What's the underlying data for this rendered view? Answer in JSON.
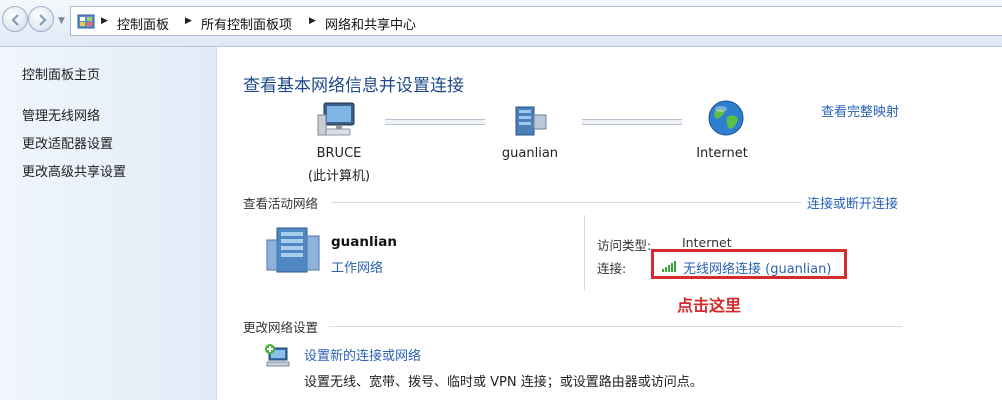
{
  "address_bar": {
    "breadcrumbs": [
      "控制面板",
      "所有控制面板项",
      "网络和共享中心"
    ]
  },
  "sidebar": {
    "home": "控制面板主页",
    "items": [
      "管理无线网络",
      "更改适配器设置",
      "更改高级共享设置"
    ]
  },
  "main": {
    "title": "查看基本网络信息并设置连接",
    "full_map_link": "查看完整映射",
    "map_nodes": [
      {
        "label": "BRUCE",
        "sublabel": "(此计算机)",
        "icon": "computer-icon"
      },
      {
        "label": "guanlian",
        "icon": "network-icon"
      },
      {
        "label": "Internet",
        "icon": "globe-icon"
      }
    ],
    "active_networks": {
      "heading": "查看活动网络",
      "connect_link": "连接或断开连接",
      "network_name": "guanlian",
      "network_type": "工作网络",
      "access_type_label": "访问类型:",
      "access_type_value": "Internet",
      "connection_label": "连接:",
      "connection_value": "无线网络连接 (guanlian)"
    },
    "annotation": "点击这里",
    "annotation_color": "#d42a2a",
    "change_settings": {
      "heading": "更改网络设置",
      "items": [
        {
          "title": "设置新的连接或网络",
          "desc": "设置无线、宽带、拨号、临时或 VPN 连接；或设置路由器或访问点。",
          "icon": "new-connection-icon"
        }
      ]
    }
  }
}
